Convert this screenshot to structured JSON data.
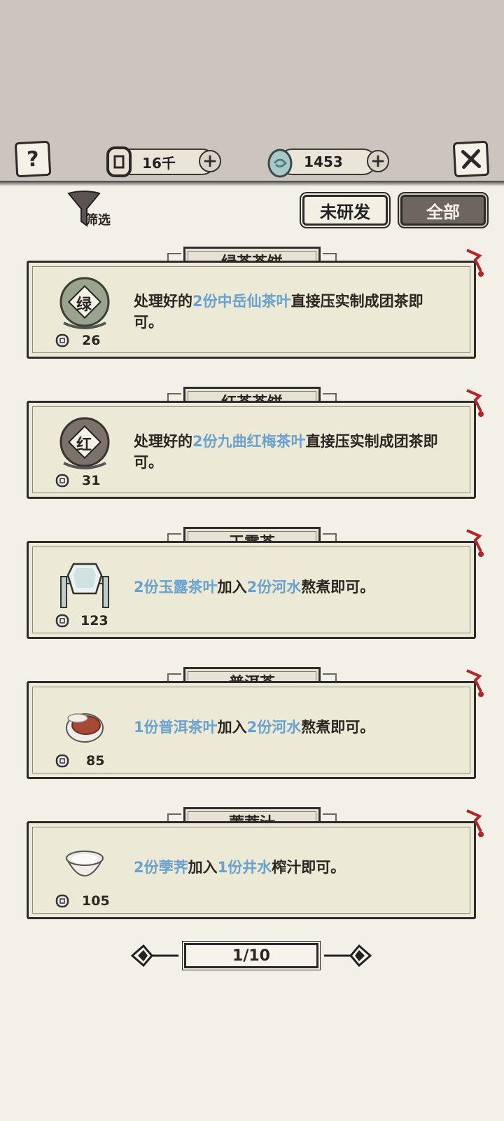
{
  "topbar": {
    "copper_value": "16千",
    "jade_value": "1453",
    "help_icon": "question-icon",
    "close_icon": "close-x-icon"
  },
  "filter": {
    "label": "筛选"
  },
  "tabs": {
    "undeveloped": "未研发",
    "all": "全部"
  },
  "recipes": [
    {
      "name": "绿茶茶饼",
      "seal": "绿",
      "price": "26",
      "desc": [
        {
          "t": "处理好的",
          "hl": false
        },
        {
          "t": "2份中岳仙茶叶",
          "hl": true
        },
        {
          "t": "直接压实制成团茶即可。",
          "hl": false
        }
      ]
    },
    {
      "name": "红茶茶饼",
      "seal": "红",
      "price": "31",
      "desc": [
        {
          "t": "处理好的",
          "hl": false
        },
        {
          "t": "2份九曲红梅茶叶",
          "hl": true
        },
        {
          "t": "直接压实制成团茶即可。",
          "hl": false
        }
      ]
    },
    {
      "name": "玉露茶",
      "price": "123",
      "desc": [
        {
          "t": "2份玉露茶叶",
          "hl": true
        },
        {
          "t": "加入",
          "hl": false
        },
        {
          "t": "2份河水",
          "hl": true
        },
        {
          "t": "熬煮即可。",
          "hl": false
        }
      ]
    },
    {
      "name": "普洱茶",
      "price": "85",
      "desc": [
        {
          "t": "1份普洱茶叶",
          "hl": true
        },
        {
          "t": "加入",
          "hl": false
        },
        {
          "t": "2份河水",
          "hl": true
        },
        {
          "t": "熬煮即可。",
          "hl": false
        }
      ]
    },
    {
      "name": "荸荠汁",
      "price": "105",
      "desc": [
        {
          "t": "2份荸荠",
          "hl": true
        },
        {
          "t": "加入",
          "hl": false
        },
        {
          "t": "1份井水",
          "hl": true
        },
        {
          "t": "榨汁即可。",
          "hl": false
        }
      ]
    }
  ],
  "pager": {
    "page": "1/10"
  },
  "colors": {
    "highlight": "#6aa1cf",
    "ink": "#2a2622",
    "paper": "#ecead6"
  }
}
